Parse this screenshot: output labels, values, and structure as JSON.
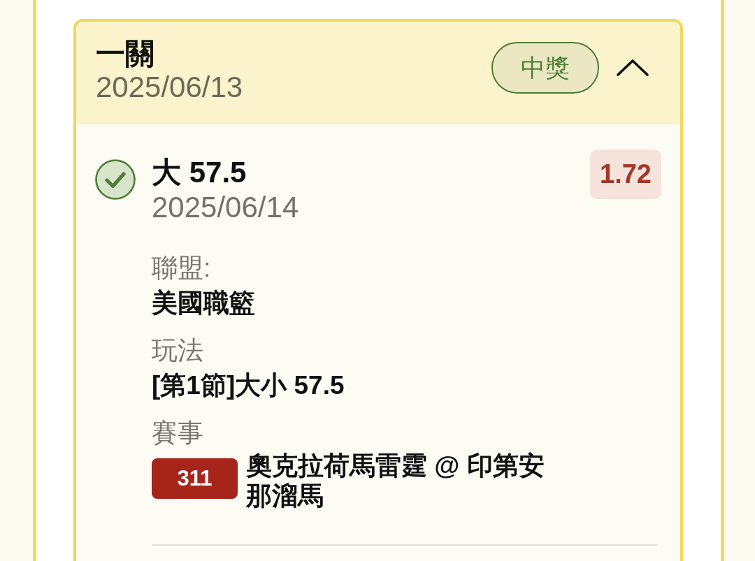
{
  "bet": {
    "title": "一關",
    "date": "2025/06/13",
    "status": {
      "label": "中獎",
      "kind": "won"
    },
    "expanded": true,
    "selections": [
      {
        "won": true,
        "pick": "大 57.5",
        "date": "2025/06/14",
        "odds": "1.72",
        "league": {
          "label": "聯盟:",
          "value": "美國職籃"
        },
        "market": {
          "label": "玩法",
          "value": "[第1節]大小 57.5"
        },
        "event": {
          "label": "賽事",
          "number": "311",
          "name": "奧克拉荷馬雷霆 @ 印第安那溜馬"
        }
      }
    ]
  }
}
